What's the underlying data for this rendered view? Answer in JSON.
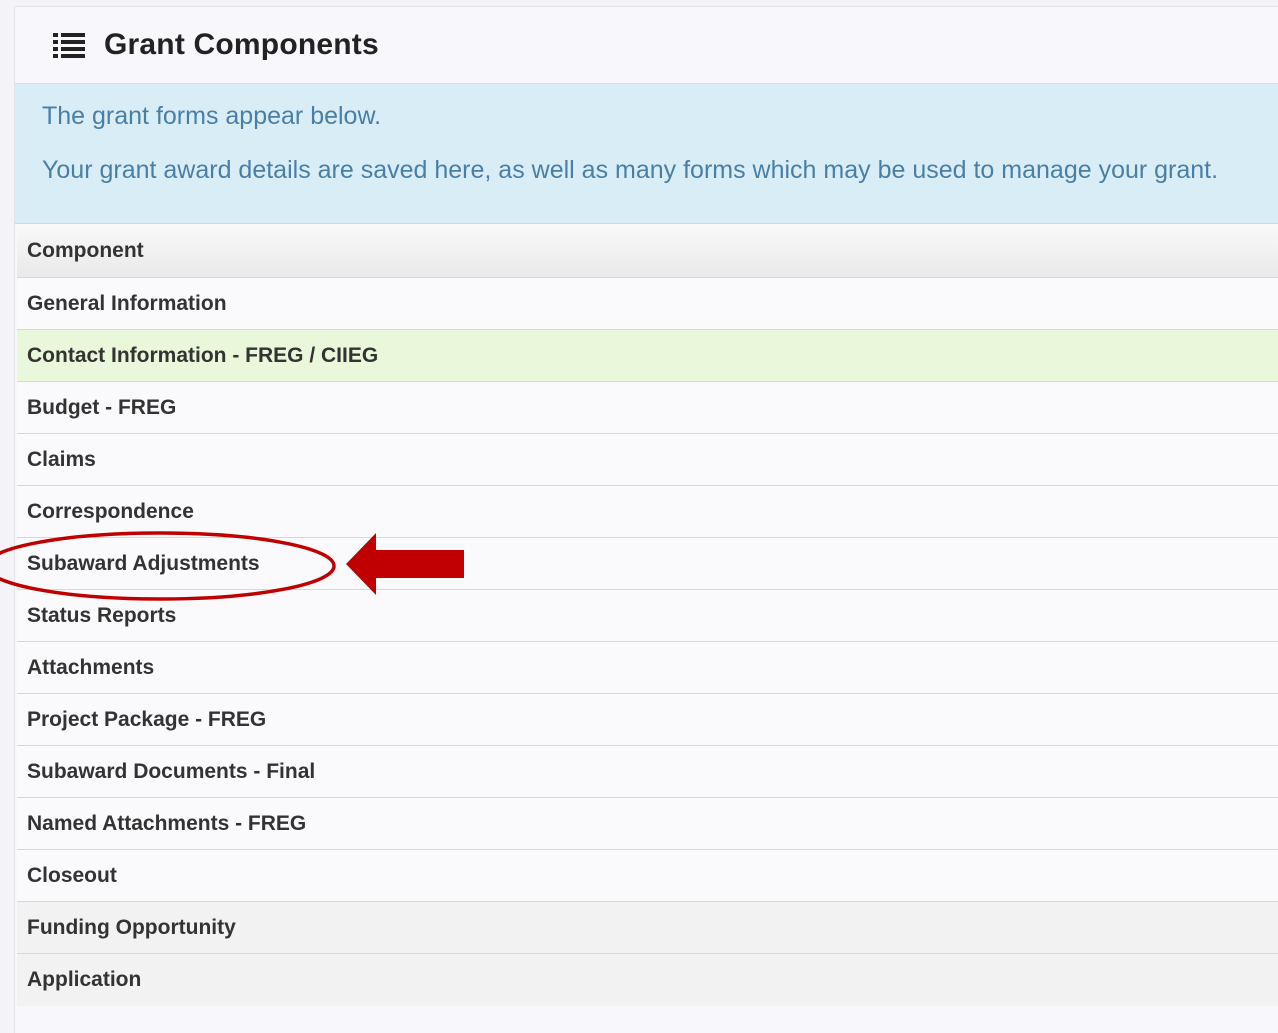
{
  "panel": {
    "title": "Grant Components",
    "title_icon": "list-icon"
  },
  "info": {
    "line1": "The grant forms appear below.",
    "line2": "Your grant award details are saved here, as well as many forms which may be used to manage your grant."
  },
  "table": {
    "header": "Component",
    "rows": [
      "General Information",
      "Contact Information - FREG / CIIEG",
      "Budget - FREG",
      "Claims",
      "Correspondence",
      "Subaward Adjustments",
      "Status Reports",
      "Attachments",
      "Project Package - FREG",
      "Subaward Documents - Final",
      "Named Attachments - FREG",
      "Closeout",
      "Funding Opportunity",
      "Application"
    ]
  },
  "annotation": {
    "highlighted_row": "Subaward Adjustments",
    "color": "#c00000"
  },
  "colors": {
    "info_bg": "#d9edf7",
    "info_text": "#4a7fa5",
    "highlight_row_bg": "#e9f7da"
  }
}
